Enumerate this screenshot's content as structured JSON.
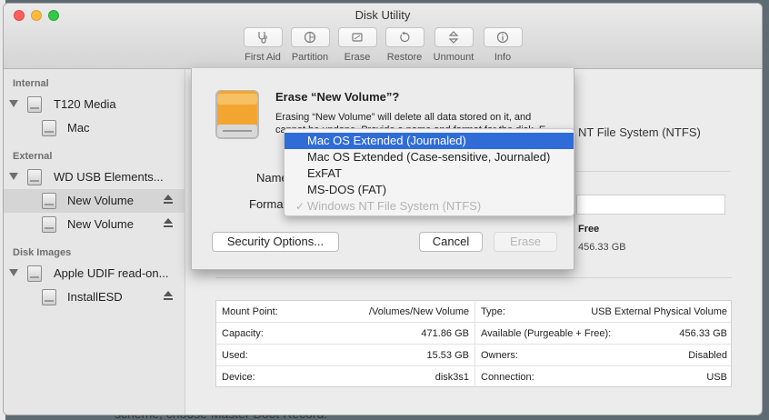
{
  "window": {
    "title": "Disk Utility"
  },
  "toolbar": {
    "first_aid": "First Aid",
    "partition": "Partition",
    "erase": "Erase",
    "restore": "Restore",
    "unmount": "Unmount",
    "info": "Info"
  },
  "sidebar": {
    "internal_header": "Internal",
    "t120_media": "T120 Media",
    "mac": "Mac",
    "external_header": "External",
    "wd_usb": "WD USB Elements...",
    "new_volume_1": "New Volume",
    "new_volume_2": "New Volume",
    "disk_images_header": "Disk Images",
    "apple_udif": "Apple UDIF read-on...",
    "install_esd": "InstallESD"
  },
  "background": {
    "format_text": "NT File System (NTFS)",
    "free_label": "Free",
    "free_value": "456.33 GB",
    "bottom_text": "scheme, choose Master Boot Record."
  },
  "info_table": {
    "mount_point_key": "Mount Point:",
    "mount_point_val": "/Volumes/New Volume",
    "capacity_key": "Capacity:",
    "capacity_val": "471.86 GB",
    "used_key": "Used:",
    "used_val": "15.53 GB",
    "device_key": "Device:",
    "device_val": "disk3s1",
    "type_key": "Type:",
    "type_val": "USB External Physical Volume",
    "available_key": "Available (Purgeable + Free):",
    "available_val": "456.33 GB",
    "owners_key": "Owners:",
    "owners_val": "Disabled",
    "connection_key": "Connection:",
    "connection_val": "USB"
  },
  "sheet": {
    "title": "Erase “New Volume”?",
    "body": "Erasing “New Volume” will delete all data stored on it, and cannot be undone. Provide a name and format for the disk. E",
    "name_label": "Name",
    "format_label": "Format",
    "security_options": "Security Options...",
    "cancel": "Cancel",
    "erase": "Erase"
  },
  "format_menu": {
    "item1": "Mac OS Extended (Journaled)",
    "item2": "Mac OS Extended (Case-sensitive, Journaled)",
    "item3": "ExFAT",
    "item4": "MS-DOS (FAT)",
    "item5": "Windows NT File System (NTFS)",
    "checkmark": "✓"
  },
  "colors": {
    "highlight": "#2f6cd8",
    "close": "#fc605c",
    "minimize": "#fdbc40",
    "maximize": "#34c84a"
  }
}
